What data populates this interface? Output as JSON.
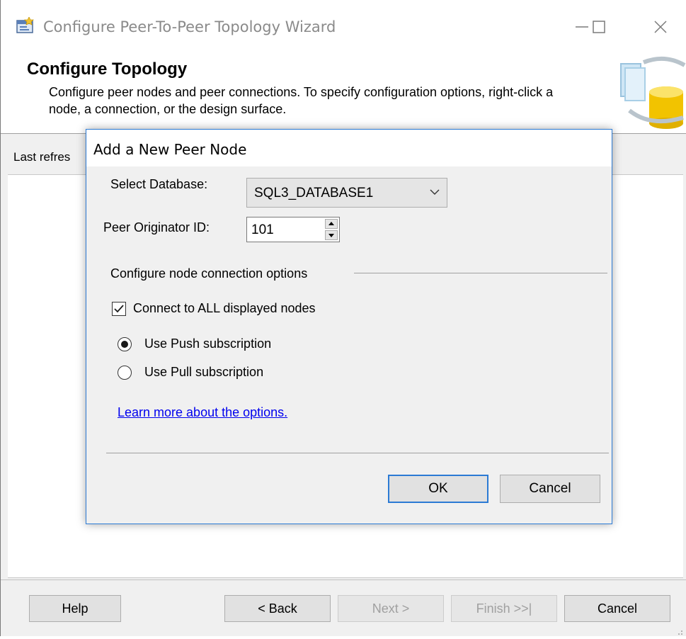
{
  "window": {
    "title": "Configure Peer-To-Peer Topology Wizard",
    "minimize_label": "—",
    "maximize_label": "☐",
    "close_label": "✕"
  },
  "header": {
    "title": "Configure Topology",
    "description": "Configure peer nodes and peer connections. To specify configuration options, right-click a node, a connection, or the design surface."
  },
  "status": {
    "text": "Last refres"
  },
  "dialog": {
    "title": "Add a New Peer Node",
    "select_database_label": "Select Database:",
    "select_database_value": "SQL3_DATABASE1",
    "peer_originator_label": "Peer Originator ID:",
    "peer_originator_value": "101",
    "group_label": "Configure node connection options",
    "connect_all_label": "Connect to ALL displayed nodes",
    "connect_all_checked": true,
    "push_label": "Use Push subscription",
    "push_selected": true,
    "pull_label": "Use Pull subscription",
    "pull_selected": false,
    "learn_more_link": "Learn more about the options.",
    "ok_label": "OK",
    "cancel_label": "Cancel"
  },
  "footer": {
    "help_label": "Help",
    "back_label": "< Back",
    "next_label": "Next >",
    "finish_label": "Finish >>|",
    "cancel_label": "Cancel"
  },
  "colors": {
    "accent": "#2b7ad4",
    "link": "#0000ee"
  }
}
